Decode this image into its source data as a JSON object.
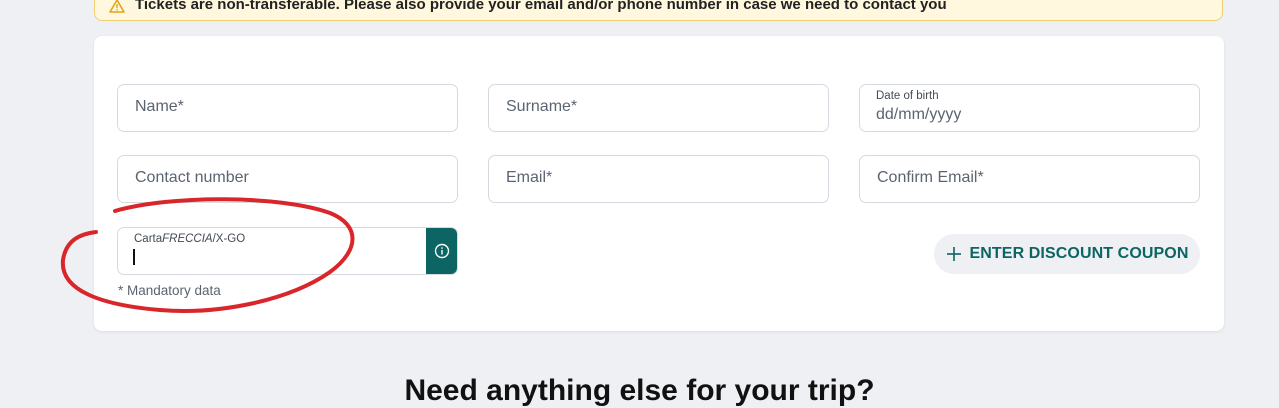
{
  "notice": {
    "text": "Tickets are non-transferable. Please also provide your email and/or phone number in case we need to contact you",
    "icon": "warning-icon"
  },
  "form": {
    "name_placeholder": "Name*",
    "surname_placeholder": "Surname*",
    "dob_label": "Date of birth",
    "dob_placeholder": "dd/mm/yyyy",
    "contact_placeholder": "Contact number",
    "email_placeholder": "Email*",
    "confirm_email_placeholder": "Confirm Email*",
    "carta_label_prefix": "Carta",
    "carta_label_italic": "FRECCIA",
    "carta_label_suffix": "/X-GO",
    "info_icon": "info-icon",
    "mandatory_note": "* Mandatory data",
    "coupon_label": "ENTER DISCOUNT COUPON",
    "coupon_icon": "plus-icon"
  },
  "section": {
    "title": "Need anything else for your trip?"
  },
  "colors": {
    "accent": "#0c6562",
    "annotation": "#d9262b",
    "notice_bg": "#fff8de",
    "page_bg": "#eef0f4"
  }
}
